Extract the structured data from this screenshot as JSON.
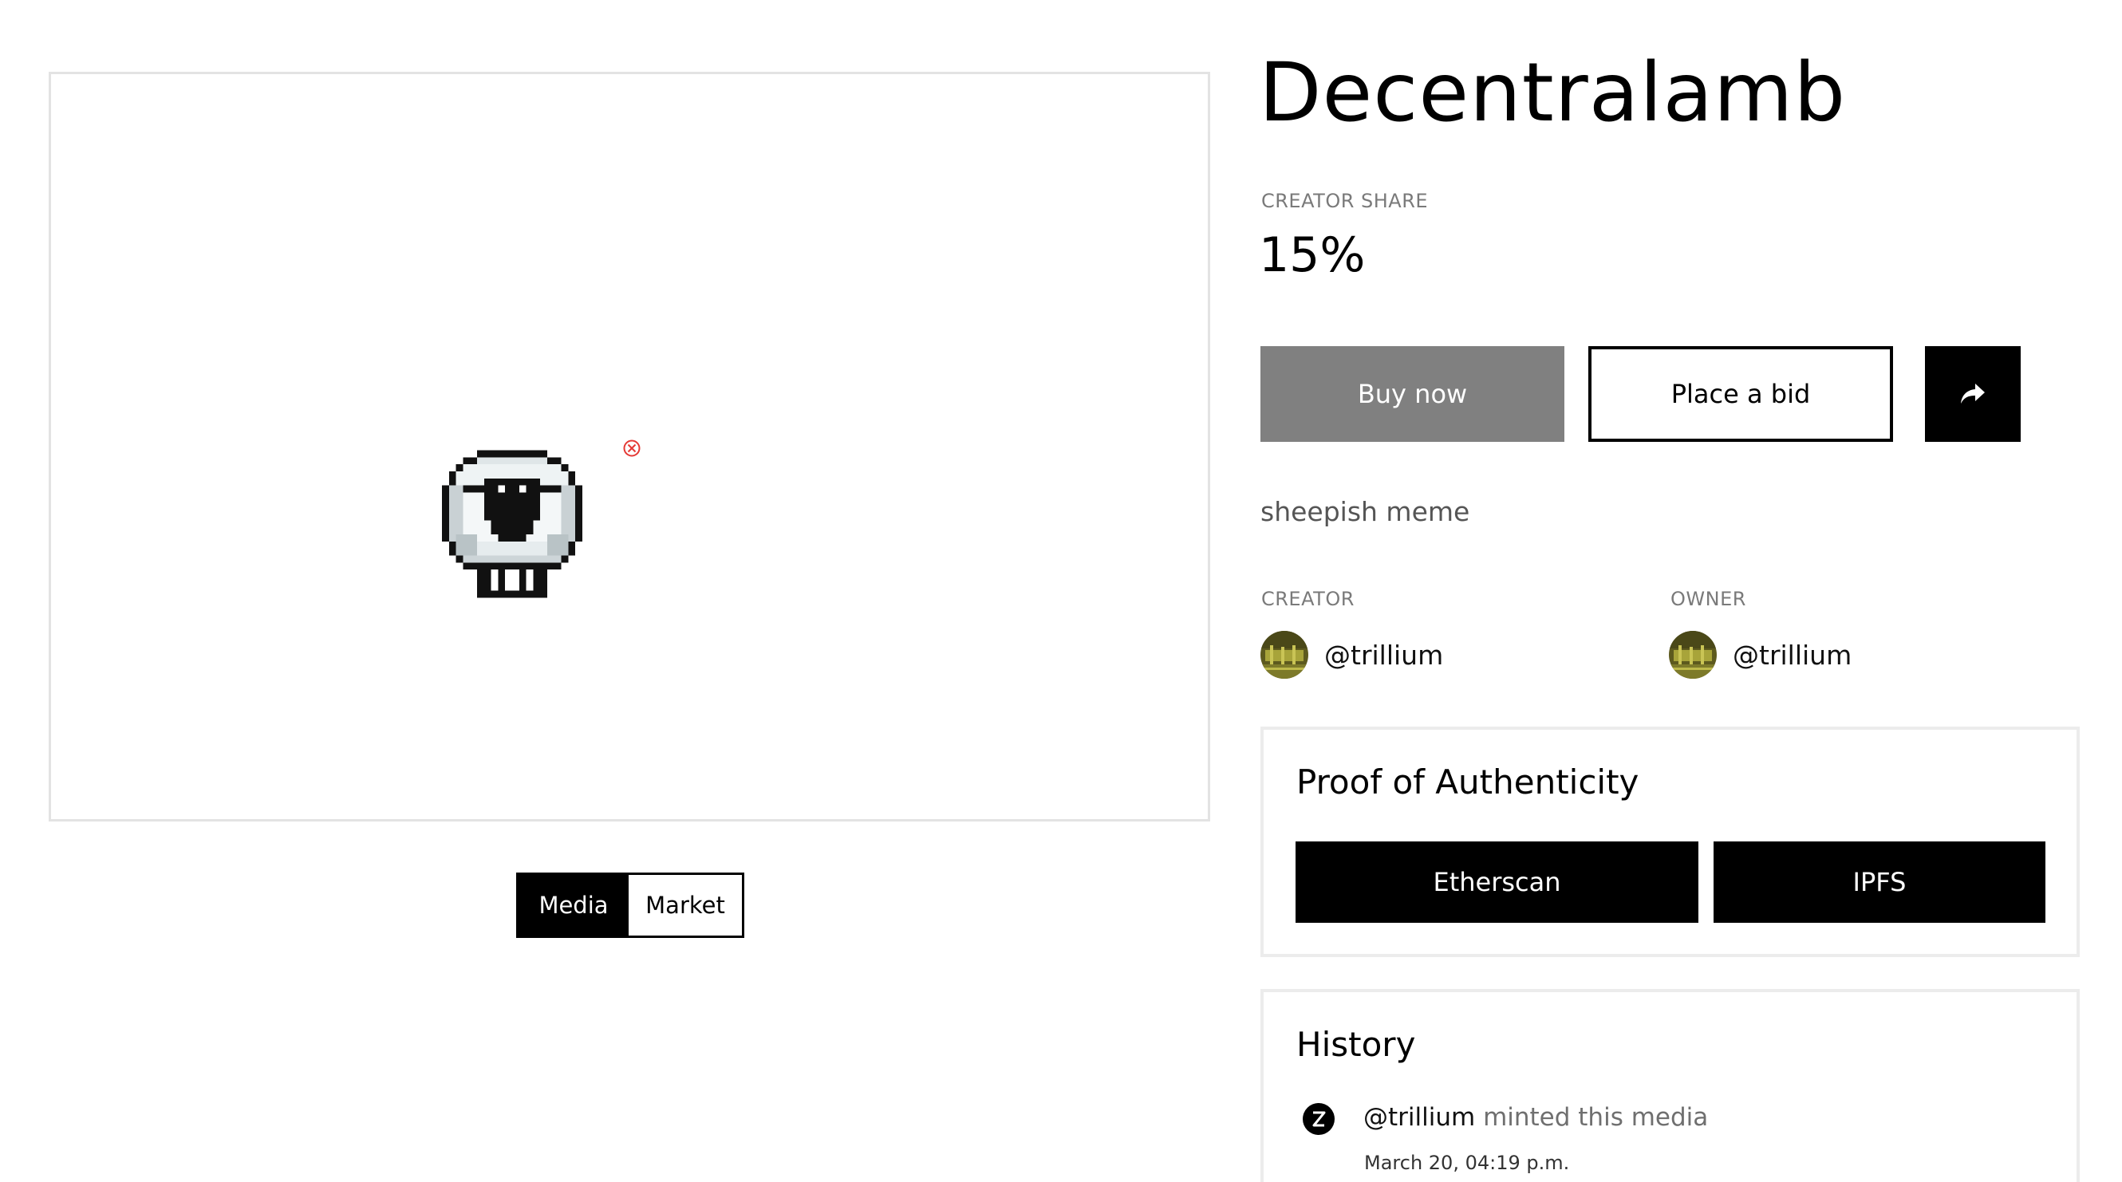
{
  "token": {
    "title": "Decentralamb",
    "description": "sheepish meme"
  },
  "creator_share": {
    "label": "CREATOR SHARE",
    "value": "15%"
  },
  "actions": {
    "buy_now_label": "Buy now",
    "place_bid_label": "Place a bid",
    "share_icon": "share-arrow-icon"
  },
  "tabs": [
    {
      "label": "Media",
      "active": true
    },
    {
      "label": "Market",
      "active": false
    }
  ],
  "creator": {
    "label": "CREATOR",
    "handle": "@trillium"
  },
  "owner": {
    "label": "OWNER",
    "handle": "@trillium"
  },
  "proof": {
    "title": "Proof of Authenticity",
    "etherscan_label": "Etherscan",
    "ipfs_label": "IPFS"
  },
  "history": {
    "title": "History",
    "events": [
      {
        "user": "@trillium",
        "action": "minted this media",
        "date": "March 20, 04:19 p.m."
      }
    ]
  },
  "colors": {
    "accent": "#000000",
    "buy_now_bg": "#808080",
    "muted_text": "#7a7a7a",
    "broken_media_icon": "#e53935",
    "avatar_tone": "#7d7a2a"
  }
}
